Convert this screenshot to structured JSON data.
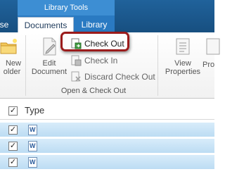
{
  "ribbon": {
    "context_group_title": "Library Tools",
    "tabs": {
      "partial": "se",
      "documents": "Documents",
      "library": "Library"
    },
    "new_folder": {
      "line1": "New",
      "line2": "older",
      "icon": "new-folder-icon"
    },
    "edit_document": {
      "line1": "Edit",
      "line2": "Document",
      "icon": "edit-document-icon"
    },
    "check_out": {
      "label": "Check Out",
      "icon": "check-out-icon"
    },
    "check_in": {
      "label": "Check In",
      "icon": "check-in-icon"
    },
    "discard_check_out": {
      "label": "Discard Check Out",
      "icon": "discard-check-out-icon"
    },
    "group_label": "Open & Check Out",
    "view_properties": {
      "line1": "View",
      "line2": "Properties",
      "icon": "view-properties-icon"
    },
    "partial_pro": {
      "label": "Pro",
      "icon": "properties-icon"
    }
  },
  "list": {
    "header": {
      "type_label": "Type",
      "checked": "✓"
    },
    "rows": [
      {
        "checked": "✓",
        "doc_icon": "W"
      },
      {
        "checked": "✓",
        "doc_icon": "W"
      },
      {
        "checked": "✓",
        "doc_icon": "W"
      }
    ]
  },
  "colors": {
    "tab_strip": "#1d5a8f",
    "context_group": "#3d8ed3",
    "highlight_ring": "#9b1b1b",
    "selected_row": "#cfe6f7"
  }
}
